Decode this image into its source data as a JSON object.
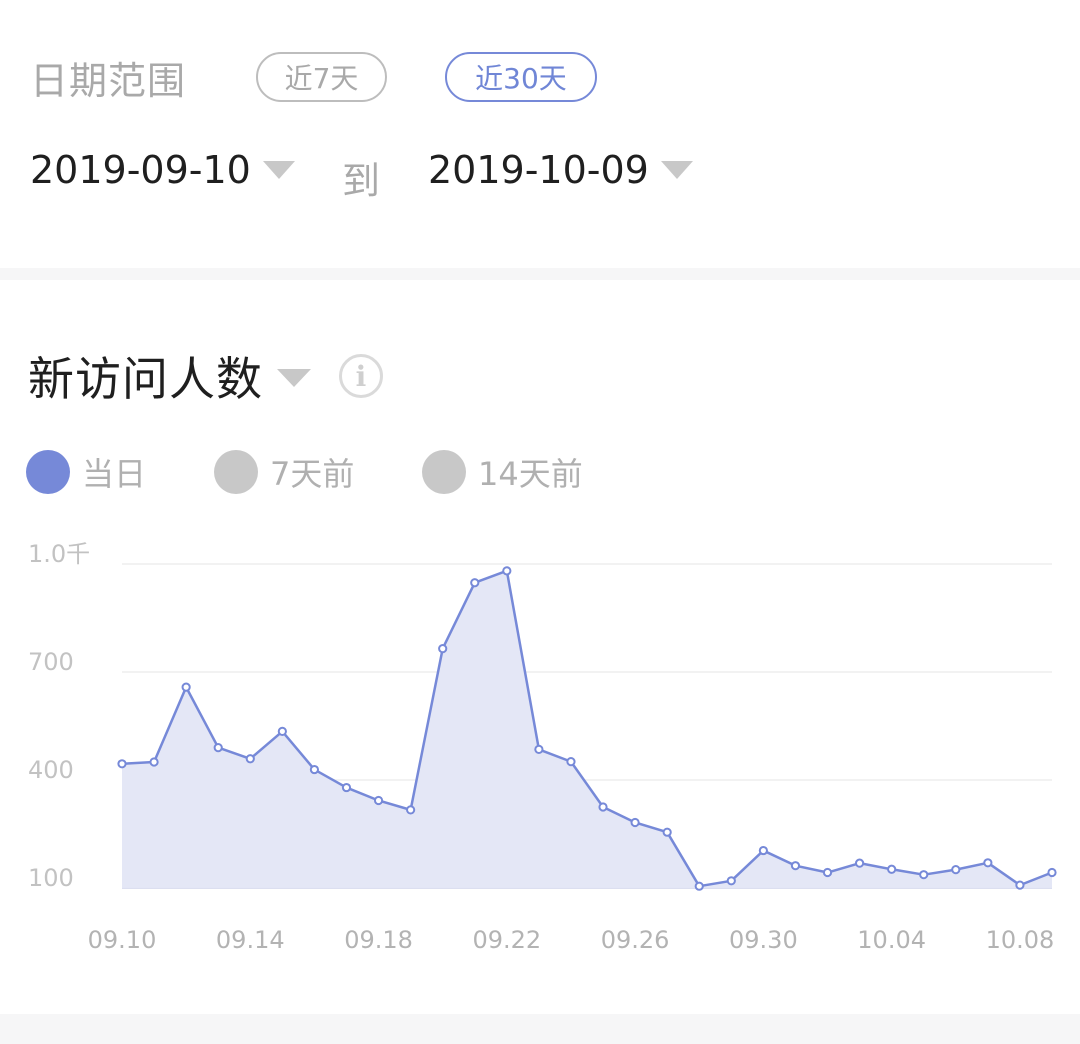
{
  "date_range": {
    "label": "日期范围",
    "presets": [
      {
        "label": "近7天",
        "active": false
      },
      {
        "label": "近30天",
        "active": true
      }
    ],
    "start_date": "2019-09-10",
    "separator": "到",
    "end_date": "2019-10-09"
  },
  "metric": {
    "title": "新访问人数",
    "info_icon": "info-icon"
  },
  "legend": [
    {
      "label": "当日",
      "color": "#7689d8",
      "active": true
    },
    {
      "label": "7天前",
      "color": "#c8c8c8",
      "active": false
    },
    {
      "label": "14天前",
      "color": "#c8c8c8",
      "active": false
    }
  ],
  "colors": {
    "accent": "#7689d8",
    "area_fill": "#e3e6f6",
    "grid": "#eeeeee",
    "baseline": "#dcdff0"
  },
  "chart_data": {
    "type": "area",
    "x": [
      "09.10",
      "09.11",
      "09.12",
      "09.13",
      "09.14",
      "09.15",
      "09.16",
      "09.17",
      "09.18",
      "09.19",
      "09.20",
      "09.21",
      "09.22",
      "09.23",
      "09.24",
      "09.25",
      "09.26",
      "09.27",
      "09.28",
      "09.29",
      "09.30",
      "10.01",
      "10.02",
      "10.03",
      "10.04",
      "10.05",
      "10.06",
      "10.07",
      "10.08",
      "10.09"
    ],
    "series": [
      {
        "values": [
          445,
          450,
          658,
          490,
          459,
          535,
          429,
          379,
          343,
          317,
          765,
          948,
          981,
          485,
          451,
          325,
          282,
          255,
          105,
          120,
          204,
          162,
          143,
          169,
          152,
          137,
          151,
          170,
          108,
          143
        ]
      }
    ],
    "x_tick_labels": [
      "09.10",
      "09.14",
      "09.18",
      "09.22",
      "09.26",
      "09.30",
      "10.04",
      "10.08"
    ],
    "y_ticks": [
      {
        "value": 100,
        "label": "100"
      },
      {
        "value": 400,
        "label": "400"
      },
      {
        "value": 700,
        "label": "700"
      },
      {
        "value": 1000,
        "label": "1.0千"
      }
    ],
    "ylim": [
      100,
      1000
    ],
    "grid": true
  }
}
